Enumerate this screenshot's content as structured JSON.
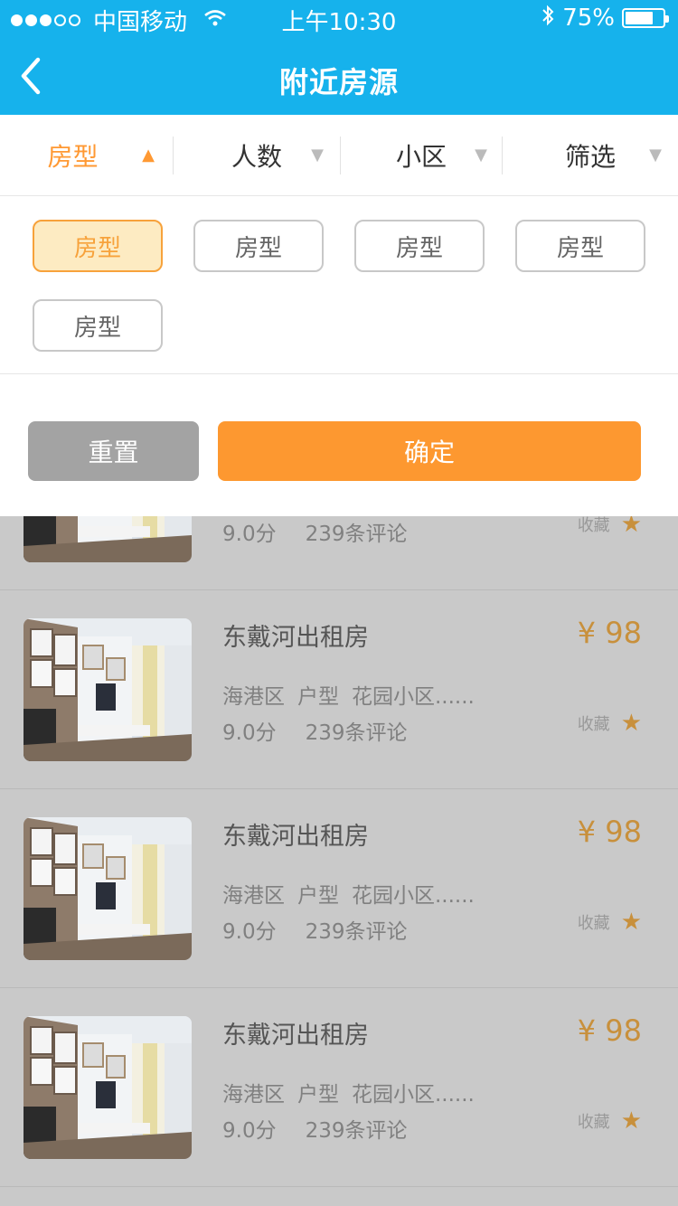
{
  "status_bar": {
    "signal_dots": [
      "full",
      "full",
      "full",
      "empty",
      "empty"
    ],
    "carrier": "中国移动",
    "wifi_icon": "wifi-icon",
    "time": "上午10:30",
    "bluetooth_icon": "bluetooth-icon",
    "battery_text": "75%",
    "battery_level": 0.75
  },
  "nav": {
    "title": "附近房源",
    "back_icon": "chevron-left-icon"
  },
  "filter_tabs": [
    {
      "label": "房型",
      "arrow": "▲",
      "active": true
    },
    {
      "label": "人数",
      "arrow": "▼",
      "active": false
    },
    {
      "label": "小区",
      "arrow": "▼",
      "active": false
    },
    {
      "label": "筛选",
      "arrow": "▼",
      "active": false
    }
  ],
  "chips": [
    {
      "label": "房型",
      "selected": true
    },
    {
      "label": "房型",
      "selected": false
    },
    {
      "label": "房型",
      "selected": false
    },
    {
      "label": "房型",
      "selected": false
    },
    {
      "label": "房型",
      "selected": false
    }
  ],
  "actions": {
    "reset_label": "重置",
    "confirm_label": "确定"
  },
  "colors": {
    "header": "#16b2ec",
    "accent": "#fd9830",
    "chip_selected_bg": "#fdebc2",
    "price": "#c8903c"
  },
  "listings": [
    {
      "name": "",
      "price": "",
      "district": "",
      "type": "",
      "community": "",
      "score": "9.0分",
      "reviews": "239条评论",
      "fav_label": "收藏"
    },
    {
      "name": "东戴河出租房",
      "price": "¥ 98",
      "district": "海港区",
      "type": "户型",
      "community": "花园小区......",
      "score": "9.0分",
      "reviews": "239条评论",
      "fav_label": "收藏"
    },
    {
      "name": "东戴河出租房",
      "price": "¥ 98",
      "district": "海港区",
      "type": "户型",
      "community": "花园小区......",
      "score": "9.0分",
      "reviews": "239条评论",
      "fav_label": "收藏"
    },
    {
      "name": "东戴河出租房",
      "price": "¥ 98",
      "district": "海港区",
      "type": "户型",
      "community": "花园小区......",
      "score": "9.0分",
      "reviews": "239条评论",
      "fav_label": "收藏"
    }
  ]
}
